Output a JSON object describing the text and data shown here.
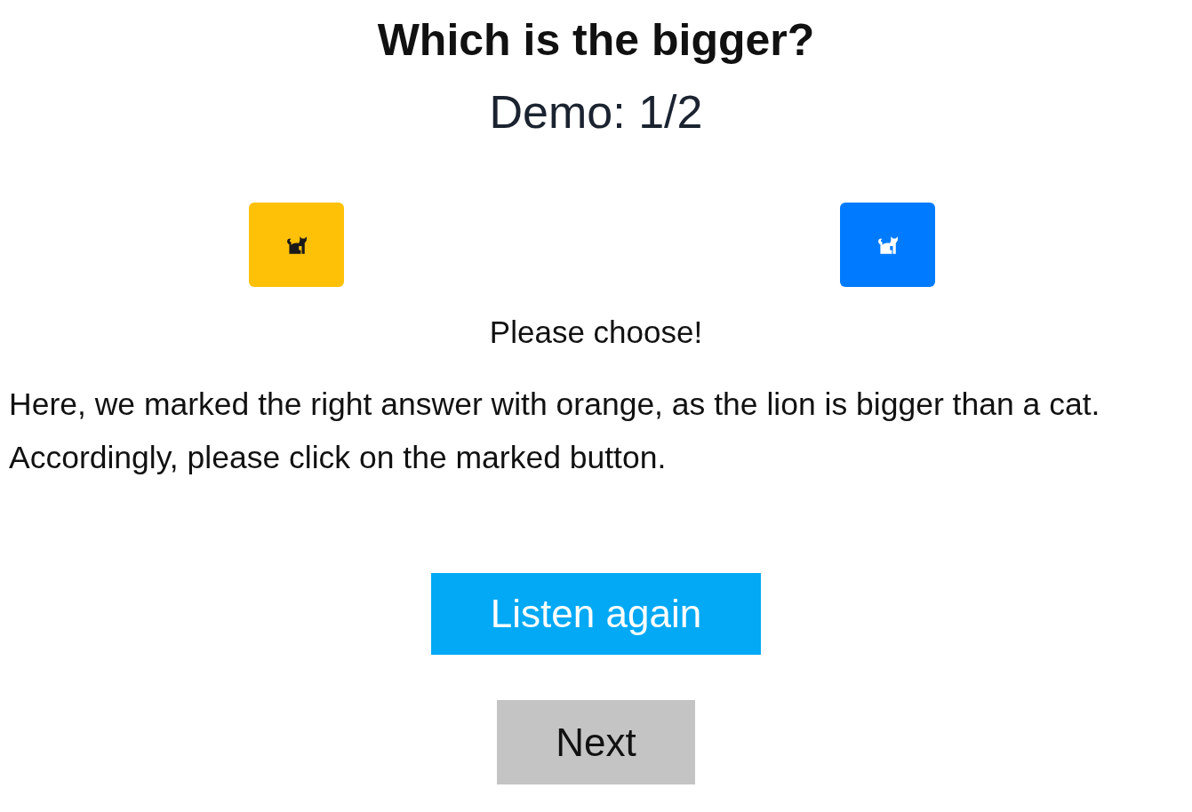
{
  "title": "Which is the bigger?",
  "progress": "Demo: 1/2",
  "choices": [
    {
      "marked": true,
      "color": "#ffc107"
    },
    {
      "marked": false,
      "color": "#007bff"
    }
  ],
  "prompt": "Please choose!",
  "instructions": "Here, we marked the right answer with orange, as the lion is bigger than a cat. Accordingly, please click on the marked button.",
  "buttons": [
    {
      "label": "Listen again",
      "kind": "primary"
    },
    {
      "label": "Next",
      "kind": "secondary"
    }
  ]
}
